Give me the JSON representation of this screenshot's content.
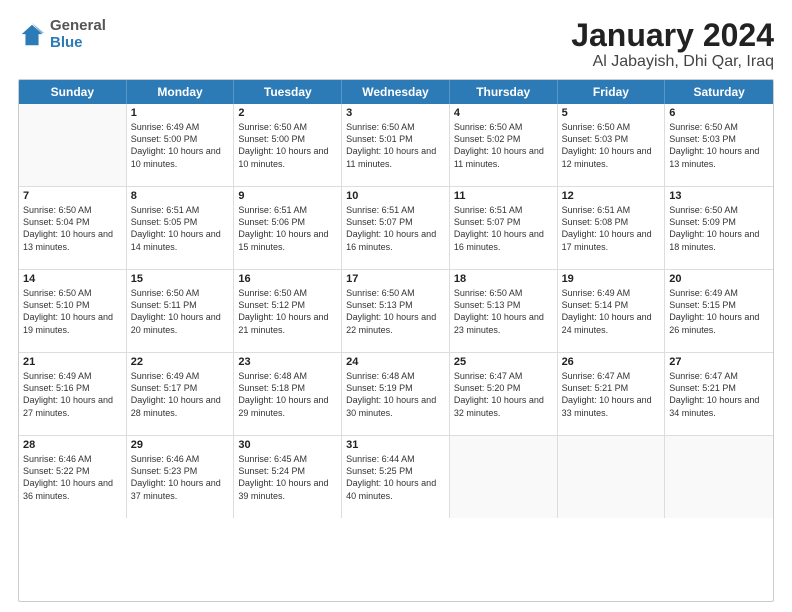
{
  "header": {
    "logo_general": "General",
    "logo_blue": "Blue",
    "title": "January 2024",
    "subtitle": "Al Jabayish, Dhi Qar, Iraq"
  },
  "weekdays": [
    "Sunday",
    "Monday",
    "Tuesday",
    "Wednesday",
    "Thursday",
    "Friday",
    "Saturday"
  ],
  "rows": [
    [
      {
        "day": "",
        "sunrise": "",
        "sunset": "",
        "daylight": ""
      },
      {
        "day": "1",
        "sunrise": "Sunrise: 6:49 AM",
        "sunset": "Sunset: 5:00 PM",
        "daylight": "Daylight: 10 hours and 10 minutes."
      },
      {
        "day": "2",
        "sunrise": "Sunrise: 6:50 AM",
        "sunset": "Sunset: 5:00 PM",
        "daylight": "Daylight: 10 hours and 10 minutes."
      },
      {
        "day": "3",
        "sunrise": "Sunrise: 6:50 AM",
        "sunset": "Sunset: 5:01 PM",
        "daylight": "Daylight: 10 hours and 11 minutes."
      },
      {
        "day": "4",
        "sunrise": "Sunrise: 6:50 AM",
        "sunset": "Sunset: 5:02 PM",
        "daylight": "Daylight: 10 hours and 11 minutes."
      },
      {
        "day": "5",
        "sunrise": "Sunrise: 6:50 AM",
        "sunset": "Sunset: 5:03 PM",
        "daylight": "Daylight: 10 hours and 12 minutes."
      },
      {
        "day": "6",
        "sunrise": "Sunrise: 6:50 AM",
        "sunset": "Sunset: 5:03 PM",
        "daylight": "Daylight: 10 hours and 13 minutes."
      }
    ],
    [
      {
        "day": "7",
        "sunrise": "Sunrise: 6:50 AM",
        "sunset": "Sunset: 5:04 PM",
        "daylight": "Daylight: 10 hours and 13 minutes."
      },
      {
        "day": "8",
        "sunrise": "Sunrise: 6:51 AM",
        "sunset": "Sunset: 5:05 PM",
        "daylight": "Daylight: 10 hours and 14 minutes."
      },
      {
        "day": "9",
        "sunrise": "Sunrise: 6:51 AM",
        "sunset": "Sunset: 5:06 PM",
        "daylight": "Daylight: 10 hours and 15 minutes."
      },
      {
        "day": "10",
        "sunrise": "Sunrise: 6:51 AM",
        "sunset": "Sunset: 5:07 PM",
        "daylight": "Daylight: 10 hours and 16 minutes."
      },
      {
        "day": "11",
        "sunrise": "Sunrise: 6:51 AM",
        "sunset": "Sunset: 5:07 PM",
        "daylight": "Daylight: 10 hours and 16 minutes."
      },
      {
        "day": "12",
        "sunrise": "Sunrise: 6:51 AM",
        "sunset": "Sunset: 5:08 PM",
        "daylight": "Daylight: 10 hours and 17 minutes."
      },
      {
        "day": "13",
        "sunrise": "Sunrise: 6:50 AM",
        "sunset": "Sunset: 5:09 PM",
        "daylight": "Daylight: 10 hours and 18 minutes."
      }
    ],
    [
      {
        "day": "14",
        "sunrise": "Sunrise: 6:50 AM",
        "sunset": "Sunset: 5:10 PM",
        "daylight": "Daylight: 10 hours and 19 minutes."
      },
      {
        "day": "15",
        "sunrise": "Sunrise: 6:50 AM",
        "sunset": "Sunset: 5:11 PM",
        "daylight": "Daylight: 10 hours and 20 minutes."
      },
      {
        "day": "16",
        "sunrise": "Sunrise: 6:50 AM",
        "sunset": "Sunset: 5:12 PM",
        "daylight": "Daylight: 10 hours and 21 minutes."
      },
      {
        "day": "17",
        "sunrise": "Sunrise: 6:50 AM",
        "sunset": "Sunset: 5:13 PM",
        "daylight": "Daylight: 10 hours and 22 minutes."
      },
      {
        "day": "18",
        "sunrise": "Sunrise: 6:50 AM",
        "sunset": "Sunset: 5:13 PM",
        "daylight": "Daylight: 10 hours and 23 minutes."
      },
      {
        "day": "19",
        "sunrise": "Sunrise: 6:49 AM",
        "sunset": "Sunset: 5:14 PM",
        "daylight": "Daylight: 10 hours and 24 minutes."
      },
      {
        "day": "20",
        "sunrise": "Sunrise: 6:49 AM",
        "sunset": "Sunset: 5:15 PM",
        "daylight": "Daylight: 10 hours and 26 minutes."
      }
    ],
    [
      {
        "day": "21",
        "sunrise": "Sunrise: 6:49 AM",
        "sunset": "Sunset: 5:16 PM",
        "daylight": "Daylight: 10 hours and 27 minutes."
      },
      {
        "day": "22",
        "sunrise": "Sunrise: 6:49 AM",
        "sunset": "Sunset: 5:17 PM",
        "daylight": "Daylight: 10 hours and 28 minutes."
      },
      {
        "day": "23",
        "sunrise": "Sunrise: 6:48 AM",
        "sunset": "Sunset: 5:18 PM",
        "daylight": "Daylight: 10 hours and 29 minutes."
      },
      {
        "day": "24",
        "sunrise": "Sunrise: 6:48 AM",
        "sunset": "Sunset: 5:19 PM",
        "daylight": "Daylight: 10 hours and 30 minutes."
      },
      {
        "day": "25",
        "sunrise": "Sunrise: 6:47 AM",
        "sunset": "Sunset: 5:20 PM",
        "daylight": "Daylight: 10 hours and 32 minutes."
      },
      {
        "day": "26",
        "sunrise": "Sunrise: 6:47 AM",
        "sunset": "Sunset: 5:21 PM",
        "daylight": "Daylight: 10 hours and 33 minutes."
      },
      {
        "day": "27",
        "sunrise": "Sunrise: 6:47 AM",
        "sunset": "Sunset: 5:21 PM",
        "daylight": "Daylight: 10 hours and 34 minutes."
      }
    ],
    [
      {
        "day": "28",
        "sunrise": "Sunrise: 6:46 AM",
        "sunset": "Sunset: 5:22 PM",
        "daylight": "Daylight: 10 hours and 36 minutes."
      },
      {
        "day": "29",
        "sunrise": "Sunrise: 6:46 AM",
        "sunset": "Sunset: 5:23 PM",
        "daylight": "Daylight: 10 hours and 37 minutes."
      },
      {
        "day": "30",
        "sunrise": "Sunrise: 6:45 AM",
        "sunset": "Sunset: 5:24 PM",
        "daylight": "Daylight: 10 hours and 39 minutes."
      },
      {
        "day": "31",
        "sunrise": "Sunrise: 6:44 AM",
        "sunset": "Sunset: 5:25 PM",
        "daylight": "Daylight: 10 hours and 40 minutes."
      },
      {
        "day": "",
        "sunrise": "",
        "sunset": "",
        "daylight": ""
      },
      {
        "day": "",
        "sunrise": "",
        "sunset": "",
        "daylight": ""
      },
      {
        "day": "",
        "sunrise": "",
        "sunset": "",
        "daylight": ""
      }
    ]
  ]
}
